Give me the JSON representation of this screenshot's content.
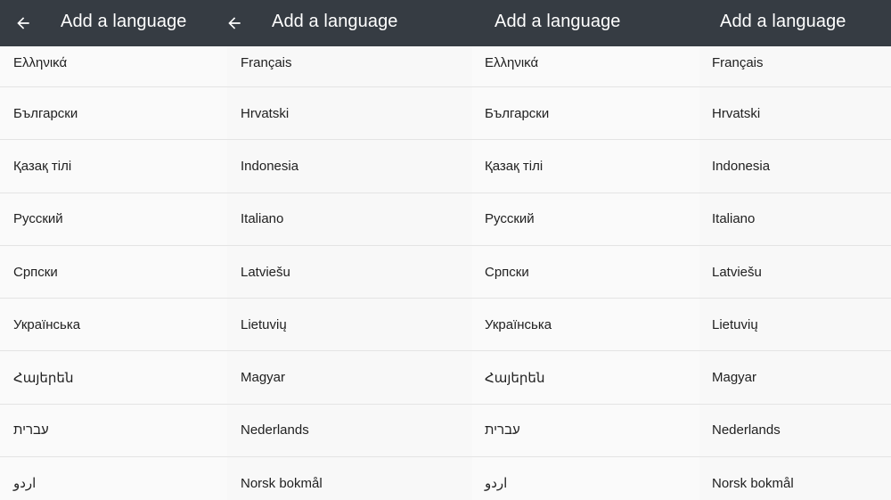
{
  "panels": [
    {
      "title": "Add a language",
      "languages": [
        "Ελληνικά",
        "Български",
        "Қазақ тілі",
        "Русский",
        "Српски",
        "Українська",
        "Հայերեն",
        "עברית",
        "اردو"
      ]
    },
    {
      "title": "Add a language",
      "languages": [
        "Français",
        "Hrvatski",
        "Indonesia",
        "Italiano",
        "Latviešu",
        "Lietuvių",
        "Magyar",
        "Nederlands",
        "Norsk bokmål"
      ]
    },
    {
      "title": "Add a language",
      "languages": [
        "Ελληνικά",
        "Български",
        "Қазақ тілі",
        "Русский",
        "Српски",
        "Українська",
        "Հայերեն",
        "עברית",
        "اردو"
      ]
    },
    {
      "title": "Add a language",
      "languages": [
        "Français",
        "Hrvatski",
        "Indonesia",
        "Italiano",
        "Latviešu",
        "Lietuvių",
        "Magyar",
        "Nederlands",
        "Norsk bokmål"
      ]
    }
  ],
  "icons": {
    "back": "arrow-back-icon"
  },
  "colors": {
    "toolbar": "#363c43",
    "background": "#fafafa",
    "divider": "#e4e4e4",
    "text": "#212121"
  }
}
